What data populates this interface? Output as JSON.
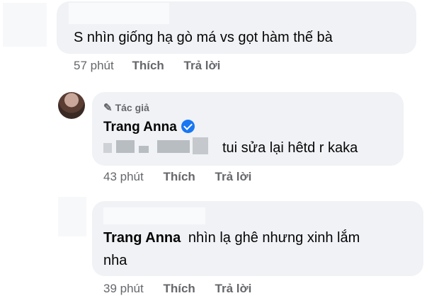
{
  "comments": [
    {
      "text": "S nhìn giống hạ gò má vs gọt hàm thế bà",
      "time": "57 phút",
      "like": "Thích",
      "reply": "Trả lời"
    },
    {
      "badge": "Tác giả",
      "author": "Trang Anna",
      "text": "tui sửa lại hêtd r kaka",
      "time": "43 phút",
      "like": "Thích",
      "reply": "Trả lời"
    },
    {
      "mention": "Trang Anna",
      "text_line1": "nhìn lạ ghê nhưng xinh lắm",
      "text_line2": "nha",
      "time": "39 phút",
      "like": "Thích",
      "reply": "Trả lời"
    }
  ],
  "icons": [
    "pen-icon",
    "verified-badge-icon",
    "avatar"
  ]
}
